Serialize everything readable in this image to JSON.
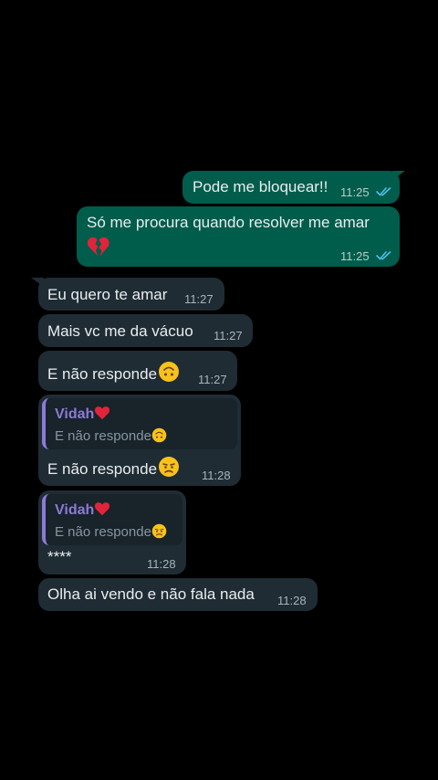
{
  "messages": [
    {
      "text": "Pode me bloquear!!",
      "time": "11:25"
    },
    {
      "text": "Só me procura quando resolver me amar",
      "time": "11:25"
    },
    {
      "text": "Eu quero te amar",
      "time": "11:27"
    },
    {
      "text": "Mais vc me da vácuo",
      "time": "11:27"
    },
    {
      "text": "E não responde",
      "time": "11:27"
    },
    {
      "quote_name": "Vidah",
      "quote_text": "E não responde",
      "text": "E não  responde",
      "time": "11:28"
    },
    {
      "quote_name": "Vidah",
      "quote_text": "E não  responde",
      "text": "****",
      "time": "11:28"
    },
    {
      "text": "Olha ai vendo e não  fala nada",
      "time": "11:28"
    }
  ],
  "icons": {
    "read_ticks": "double-check-icon",
    "broken_heart": "broken-heart-icon",
    "upside_down_face": "upside-down-face-icon",
    "disappointed_face": "disappointed-face-icon",
    "red_heart": "heart-icon"
  },
  "colors": {
    "outgoing": "#005c4b",
    "incoming": "#1f2c34",
    "quote_accent": "#8c7ad6",
    "read_ticks": "#53bdeb"
  }
}
